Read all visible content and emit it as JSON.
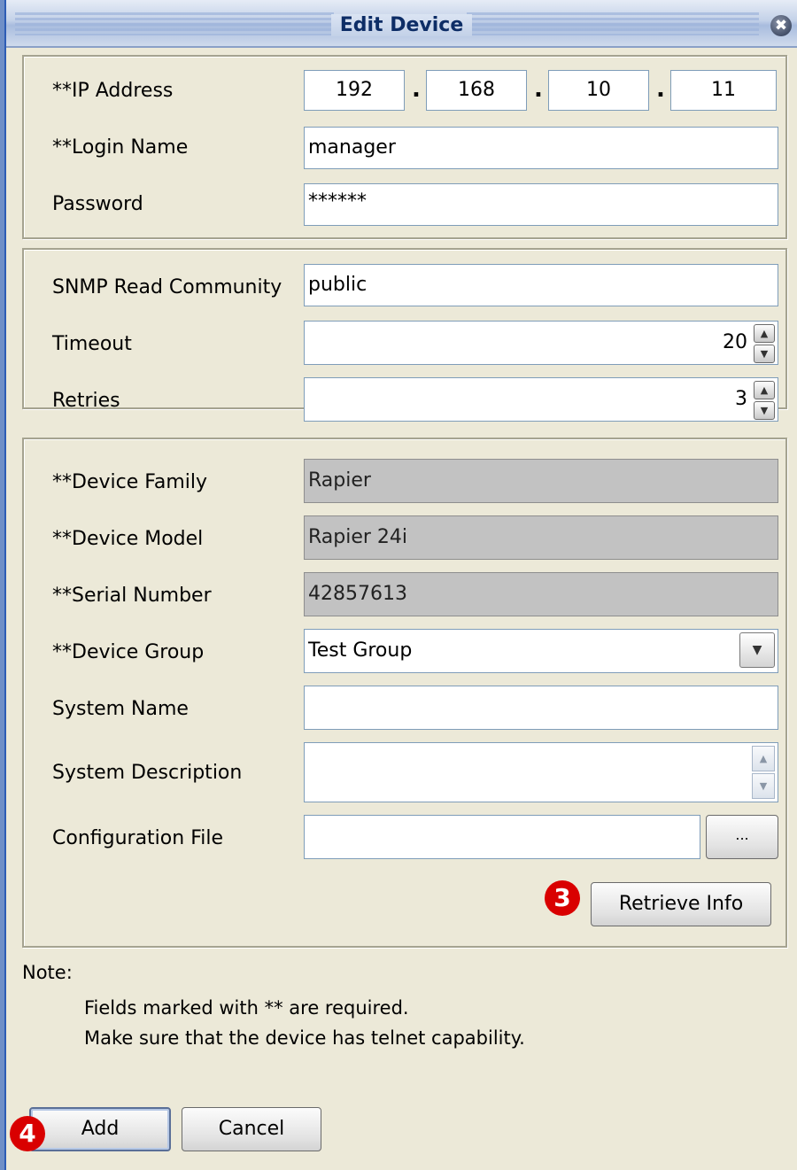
{
  "dialog": {
    "title": "Edit Device",
    "close_glyph": "✖"
  },
  "connection": {
    "ip_label": "**IP Address",
    "ip_octets": [
      "192",
      "168",
      "10",
      "11"
    ],
    "ip_separator": ".",
    "login_label": "**Login Name",
    "login_value": "manager",
    "password_label": "Password",
    "password_value": "******"
  },
  "snmp": {
    "community_label": "SNMP Read Community",
    "community_value": "public",
    "timeout_label": "Timeout",
    "timeout_value": "20",
    "retries_label": "Retries",
    "retries_value": "3",
    "spin_up": "▲",
    "spin_down": "▼"
  },
  "device": {
    "family_label": "**Device Family",
    "family_value": "Rapier",
    "model_label": "**Device Model",
    "model_value": "Rapier 24i",
    "serial_label": "**Serial Number",
    "serial_value": "42857613",
    "group_label": "**Device Group",
    "group_value": "Test Group",
    "group_dropdown_glyph": "▼",
    "sysname_label": "System Name",
    "sysname_value": "",
    "sysdesc_label": "System Description",
    "sysdesc_value": "",
    "config_label": "Configuration File",
    "config_value": "",
    "browse_label": "...",
    "retrieve_label": "Retrieve Info"
  },
  "note": {
    "heading": "Note:",
    "lines": [
      "Fields marked with ** are required.",
      "Make sure that the device has telnet capability."
    ]
  },
  "footer": {
    "add_label": "Add",
    "cancel_label": "Cancel"
  },
  "callouts": {
    "retrieve_step": "3",
    "add_step": "4"
  },
  "icons": [
    "close-icon",
    "spin-up-icon",
    "spin-down-icon",
    "dropdown-arrow-icon",
    "scroll-up-icon",
    "scroll-down-icon"
  ],
  "colors": {
    "dialog_bg": "#ece9d8",
    "title_text": "#0d2d66",
    "readonly_field_bg": "#c2c2c2",
    "callout_red": "#d90000",
    "field_border": "#7f9db9"
  }
}
